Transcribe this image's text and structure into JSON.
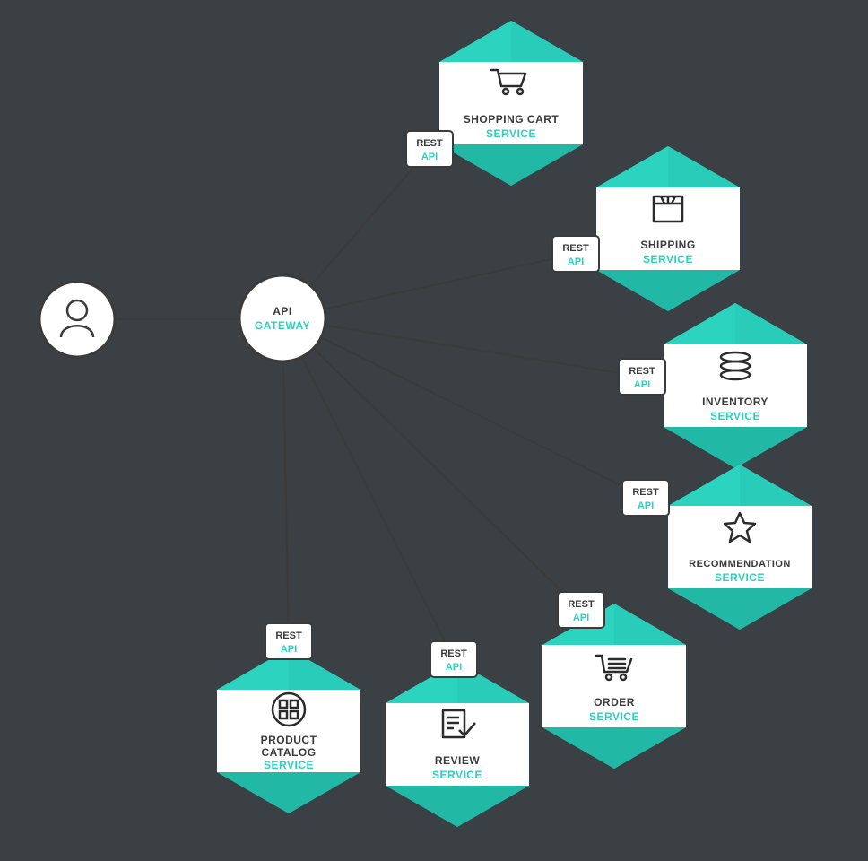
{
  "diagram": {
    "colors": {
      "bg": "#3b4044",
      "hex_fill": "#2cd3bf",
      "hex_dark": "#21b8a6",
      "card": "#ffffff",
      "stroke": "#3b3b3b",
      "accent": "#2ad1bd"
    },
    "user_node": {
      "label": ""
    },
    "gateway": {
      "line1": "API",
      "line2": "GATEWAY"
    },
    "rest_badge": {
      "line1": "REST",
      "line2": "API"
    },
    "services": [
      {
        "id": "cart",
        "line1": "SHOPPING CART",
        "line2": "SERVICE",
        "icon": "cart"
      },
      {
        "id": "shipping",
        "line1": "SHIPPING",
        "line2": "SERVICE",
        "icon": "box"
      },
      {
        "id": "inventory",
        "line1": "INVENTORY",
        "line2": "SERVICE",
        "icon": "stack"
      },
      {
        "id": "recommend",
        "line1": "RECOMMENDATION",
        "line2": "SERVICE",
        "icon": "star"
      },
      {
        "id": "order",
        "line1": "ORDER",
        "line2": "SERVICE",
        "icon": "ordercart"
      },
      {
        "id": "review",
        "line1": "REVIEW",
        "line2": "SERVICE",
        "icon": "doccheck"
      },
      {
        "id": "catalog",
        "line1": "PRODUCT",
        "line1b": "CATALOG",
        "line2": "SERVICE",
        "icon": "grid"
      }
    ]
  }
}
